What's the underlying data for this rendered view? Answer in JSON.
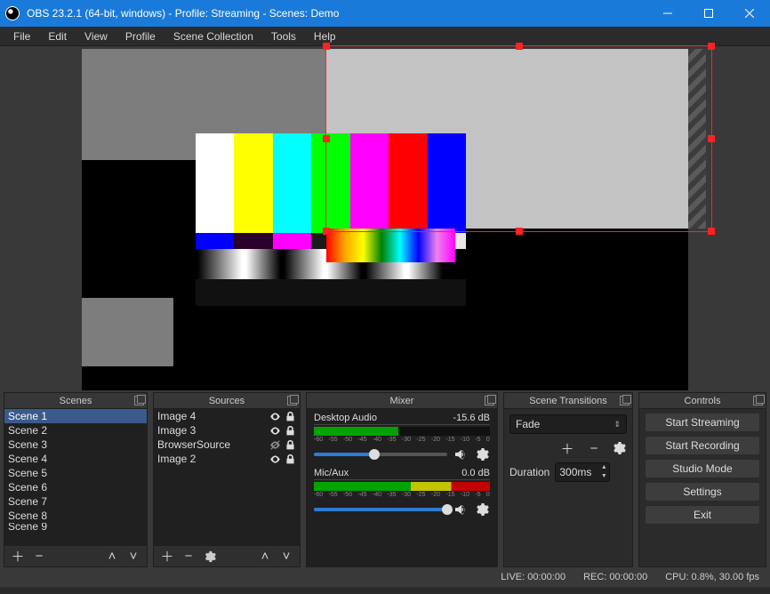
{
  "window": {
    "title": "OBS 23.2.1 (64-bit, windows) - Profile: Streaming - Scenes: Demo"
  },
  "menu": [
    "File",
    "Edit",
    "View",
    "Profile",
    "Scene Collection",
    "Tools",
    "Help"
  ],
  "scenes": {
    "title": "Scenes",
    "items": [
      "Scene 1",
      "Scene 2",
      "Scene 3",
      "Scene 4",
      "Scene 5",
      "Scene 6",
      "Scene 7",
      "Scene 8",
      "Scene 9"
    ],
    "selected": 0
  },
  "sources": {
    "title": "Sources",
    "items": [
      {
        "name": "Image 4",
        "visible": true,
        "locked": true
      },
      {
        "name": "Image 3",
        "visible": true,
        "locked": true
      },
      {
        "name": "BrowserSource",
        "visible": false,
        "locked": true
      },
      {
        "name": "Image 2",
        "visible": true,
        "locked": true
      }
    ]
  },
  "mixer": {
    "title": "Mixer",
    "tracks": [
      {
        "name": "Desktop Audio",
        "db": "-15.6 dB",
        "level_pct": 48,
        "slider_pct": 45
      },
      {
        "name": "Mic/Aux",
        "db": "0.0 dB",
        "level_pct": 100,
        "slider_pct": 100
      }
    ],
    "ticks": [
      "-60",
      "-55",
      "-50",
      "-45",
      "-40",
      "-35",
      "-30",
      "-25",
      "-20",
      "-15",
      "-10",
      "-5",
      "0"
    ]
  },
  "transitions": {
    "title": "Scene Transitions",
    "value": "Fade",
    "duration_label": "Duration",
    "duration_value": "300ms"
  },
  "controls": {
    "title": "Controls",
    "buttons": [
      "Start Streaming",
      "Start Recording",
      "Studio Mode",
      "Settings",
      "Exit"
    ]
  },
  "status": {
    "live": "LIVE: 00:00:00",
    "rec": "REC: 00:00:00",
    "cpu": "CPU: 0.8%, 30.00 fps"
  }
}
